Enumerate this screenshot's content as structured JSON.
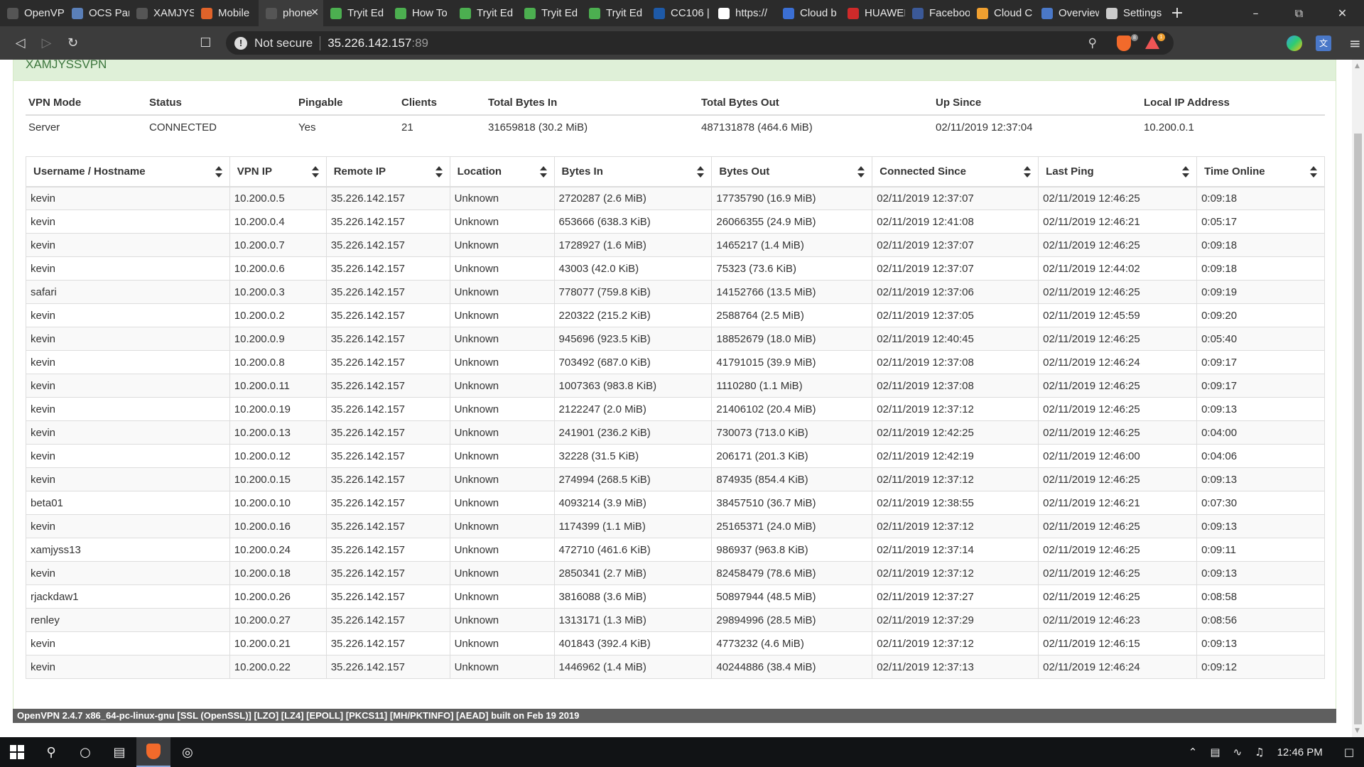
{
  "browser": {
    "tabs": [
      {
        "label": "OpenVPN",
        "icon": "globe-icon",
        "color": "#555555",
        "active": false
      },
      {
        "label": "OCS Pane",
        "icon": "box-icon",
        "color": "#5a7fb8",
        "active": false
      },
      {
        "label": "XAMJYSS",
        "icon": "globe-icon",
        "color": "#555555",
        "active": false
      },
      {
        "label": "Mobile",
        "icon": "lion-icon",
        "color": "#e0632a",
        "active": false
      },
      {
        "label": "phone",
        "icon": "globe-icon",
        "color": "#555555",
        "active": true
      },
      {
        "label": "Tryit Ed",
        "icon": "w3-icon",
        "color": "#4caf50",
        "active": false
      },
      {
        "label": "How To",
        "icon": "w3-icon",
        "color": "#4caf50",
        "active": false
      },
      {
        "label": "Tryit Ed",
        "icon": "w3-icon",
        "color": "#4caf50",
        "active": false
      },
      {
        "label": "Tryit Ed",
        "icon": "w3-icon",
        "color": "#4caf50",
        "active": false
      },
      {
        "label": "Tryit Ed",
        "icon": "w3-icon",
        "color": "#4caf50",
        "active": false
      },
      {
        "label": "CC106 |",
        "icon": "classroom-icon",
        "color": "#1e5aa8",
        "active": false
      },
      {
        "label": "https://",
        "icon": "mail-icon",
        "color": "#ffffff",
        "active": false
      },
      {
        "label": "Cloud b",
        "icon": "a-icon",
        "color": "#3b6fd4",
        "active": false
      },
      {
        "label": "HUAWEI",
        "icon": "huawei-icon",
        "color": "#cf2a2a",
        "active": false
      },
      {
        "label": "Facebook",
        "icon": "facebook-icon",
        "color": "#3b5998",
        "active": false
      },
      {
        "label": "Cloud C",
        "icon": "cloud-icon",
        "color": "#f0a030",
        "active": false
      },
      {
        "label": "Overview",
        "icon": "window-icon",
        "color": "#4a78c8",
        "active": false
      },
      {
        "label": "Settings",
        "icon": "gear-icon",
        "color": "#cccccc",
        "active": false
      }
    ],
    "address": {
      "security_label": "Not secure",
      "host": "35.226.142.157",
      "port": ":89"
    },
    "shield_count": "8",
    "rewards_count": "1"
  },
  "panel": {
    "title": "XAMJYSSVPN"
  },
  "status_table": {
    "headers": [
      "VPN Mode",
      "Status",
      "Pingable",
      "Clients",
      "Total Bytes In",
      "Total Bytes Out",
      "Up Since",
      "Local IP Address"
    ],
    "row": [
      "Server",
      "CONNECTED",
      "Yes",
      "21",
      "31659818 (30.2 MiB)",
      "487131878 (464.6 MiB)",
      "02/11/2019 12:37:04",
      "10.200.0.1"
    ]
  },
  "clients_table": {
    "headers": [
      "Username / Hostname",
      "VPN IP",
      "Remote IP",
      "Location",
      "Bytes In",
      "Bytes Out",
      "Connected Since",
      "Last Ping",
      "Time Online"
    ],
    "rows": [
      [
        "kevin",
        "10.200.0.5",
        "35.226.142.157",
        "Unknown",
        "2720287 (2.6 MiB)",
        "17735790 (16.9 MiB)",
        "02/11/2019 12:37:07",
        "02/11/2019 12:46:25",
        "0:09:18"
      ],
      [
        "kevin",
        "10.200.0.4",
        "35.226.142.157",
        "Unknown",
        "653666 (638.3 KiB)",
        "26066355 (24.9 MiB)",
        "02/11/2019 12:41:08",
        "02/11/2019 12:46:21",
        "0:05:17"
      ],
      [
        "kevin",
        "10.200.0.7",
        "35.226.142.157",
        "Unknown",
        "1728927 (1.6 MiB)",
        "1465217 (1.4 MiB)",
        "02/11/2019 12:37:07",
        "02/11/2019 12:46:25",
        "0:09:18"
      ],
      [
        "kevin",
        "10.200.0.6",
        "35.226.142.157",
        "Unknown",
        "43003 (42.0 KiB)",
        "75323 (73.6 KiB)",
        "02/11/2019 12:37:07",
        "02/11/2019 12:44:02",
        "0:09:18"
      ],
      [
        "safari",
        "10.200.0.3",
        "35.226.142.157",
        "Unknown",
        "778077 (759.8 KiB)",
        "14152766 (13.5 MiB)",
        "02/11/2019 12:37:06",
        "02/11/2019 12:46:25",
        "0:09:19"
      ],
      [
        "kevin",
        "10.200.0.2",
        "35.226.142.157",
        "Unknown",
        "220322 (215.2 KiB)",
        "2588764 (2.5 MiB)",
        "02/11/2019 12:37:05",
        "02/11/2019 12:45:59",
        "0:09:20"
      ],
      [
        "kevin",
        "10.200.0.9",
        "35.226.142.157",
        "Unknown",
        "945696 (923.5 KiB)",
        "18852679 (18.0 MiB)",
        "02/11/2019 12:40:45",
        "02/11/2019 12:46:25",
        "0:05:40"
      ],
      [
        "kevin",
        "10.200.0.8",
        "35.226.142.157",
        "Unknown",
        "703492 (687.0 KiB)",
        "41791015 (39.9 MiB)",
        "02/11/2019 12:37:08",
        "02/11/2019 12:46:24",
        "0:09:17"
      ],
      [
        "kevin",
        "10.200.0.11",
        "35.226.142.157",
        "Unknown",
        "1007363 (983.8 KiB)",
        "1110280 (1.1 MiB)",
        "02/11/2019 12:37:08",
        "02/11/2019 12:46:25",
        "0:09:17"
      ],
      [
        "kevin",
        "10.200.0.19",
        "35.226.142.157",
        "Unknown",
        "2122247 (2.0 MiB)",
        "21406102 (20.4 MiB)",
        "02/11/2019 12:37:12",
        "02/11/2019 12:46:25",
        "0:09:13"
      ],
      [
        "kevin",
        "10.200.0.13",
        "35.226.142.157",
        "Unknown",
        "241901 (236.2 KiB)",
        "730073 (713.0 KiB)",
        "02/11/2019 12:42:25",
        "02/11/2019 12:46:25",
        "0:04:00"
      ],
      [
        "kevin",
        "10.200.0.12",
        "35.226.142.157",
        "Unknown",
        "32228 (31.5 KiB)",
        "206171 (201.3 KiB)",
        "02/11/2019 12:42:19",
        "02/11/2019 12:46:00",
        "0:04:06"
      ],
      [
        "kevin",
        "10.200.0.15",
        "35.226.142.157",
        "Unknown",
        "274994 (268.5 KiB)",
        "874935 (854.4 KiB)",
        "02/11/2019 12:37:12",
        "02/11/2019 12:46:25",
        "0:09:13"
      ],
      [
        "beta01",
        "10.200.0.10",
        "35.226.142.157",
        "Unknown",
        "4093214 (3.9 MiB)",
        "38457510 (36.7 MiB)",
        "02/11/2019 12:38:55",
        "02/11/2019 12:46:21",
        "0:07:30"
      ],
      [
        "kevin",
        "10.200.0.16",
        "35.226.142.157",
        "Unknown",
        "1174399 (1.1 MiB)",
        "25165371 (24.0 MiB)",
        "02/11/2019 12:37:12",
        "02/11/2019 12:46:25",
        "0:09:13"
      ],
      [
        "xamjyss13",
        "10.200.0.24",
        "35.226.142.157",
        "Unknown",
        "472710 (461.6 KiB)",
        "986937 (963.8 KiB)",
        "02/11/2019 12:37:14",
        "02/11/2019 12:46:25",
        "0:09:11"
      ],
      [
        "kevin",
        "10.200.0.18",
        "35.226.142.157",
        "Unknown",
        "2850341 (2.7 MiB)",
        "82458479 (78.6 MiB)",
        "02/11/2019 12:37:12",
        "02/11/2019 12:46:25",
        "0:09:13"
      ],
      [
        "rjackdaw1",
        "10.200.0.26",
        "35.226.142.157",
        "Unknown",
        "3816088 (3.6 MiB)",
        "50897944 (48.5 MiB)",
        "02/11/2019 12:37:27",
        "02/11/2019 12:46:25",
        "0:08:58"
      ],
      [
        "renley",
        "10.200.0.27",
        "35.226.142.157",
        "Unknown",
        "1313171 (1.3 MiB)",
        "29894996 (28.5 MiB)",
        "02/11/2019 12:37:29",
        "02/11/2019 12:46:23",
        "0:08:56"
      ],
      [
        "kevin",
        "10.200.0.21",
        "35.226.142.157",
        "Unknown",
        "401843 (392.4 KiB)",
        "4773232 (4.6 MiB)",
        "02/11/2019 12:37:12",
        "02/11/2019 12:46:15",
        "0:09:13"
      ],
      [
        "kevin",
        "10.200.0.22",
        "35.226.142.157",
        "Unknown",
        "1446962 (1.4 MiB)",
        "40244886 (38.4 MiB)",
        "02/11/2019 12:37:13",
        "02/11/2019 12:46:24",
        "0:09:12"
      ]
    ]
  },
  "footer": {
    "text": "OpenVPN 2.4.7 x86_64-pc-linux-gnu [SSL (OpenSSL)] [LZO] [LZ4] [EPOLL] [PKCS11] [MH/PKTINFO] [AEAD] built on Feb 19 2019"
  },
  "taskbar": {
    "clock": "12:46 PM"
  },
  "colors": {
    "panel_heading_bg": "#dff0d8",
    "panel_heading_text": "#3c763d",
    "footer_bg": "#5f5f5f",
    "browser_chrome": "#3c3c3c",
    "tab_strip": "#2b2b2b",
    "taskbar": "#111315"
  }
}
